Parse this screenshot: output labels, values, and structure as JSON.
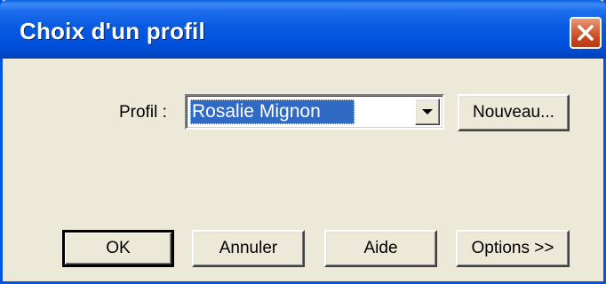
{
  "window": {
    "title": "Choix d'un profil",
    "close_icon": "close-icon"
  },
  "profile": {
    "label": "Profil :",
    "selected_value": "Rosalie Mignon",
    "dropdown_icon": "chevron-down-icon",
    "new_button_label": "Nouveau..."
  },
  "buttons": {
    "ok_label": "OK",
    "cancel_label": "Annuler",
    "help_label": "Aide",
    "options_label": "Options >>"
  },
  "colors": {
    "titlebar": "#0054e3",
    "close_button": "#d86b45",
    "selection": "#316ac5",
    "dialog_background": "#ece9d8"
  }
}
